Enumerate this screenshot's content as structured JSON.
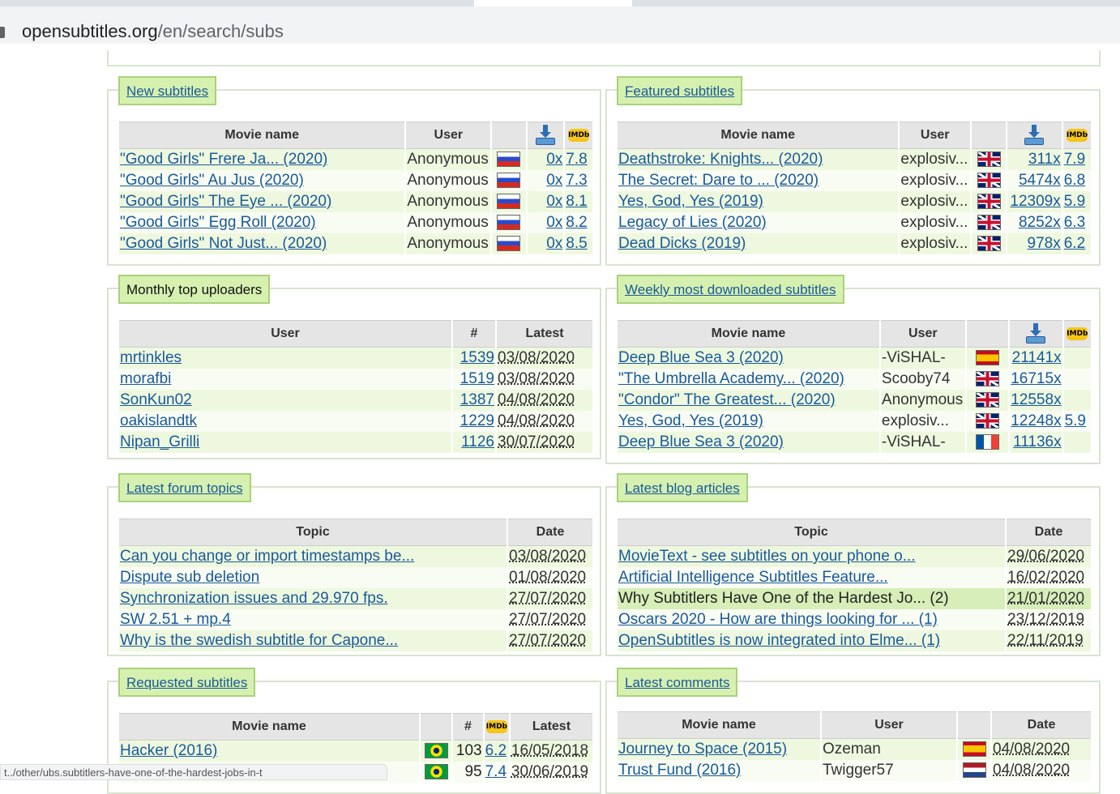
{
  "browser": {
    "url_host": "opensubtitles.org",
    "url_path": "/en/search/subs"
  },
  "new_subtitles": {
    "title": "New subtitles",
    "headers": [
      "Movie name",
      "User"
    ],
    "rows": [
      {
        "movie": "\"Good Girls\" Frere Ja... (2020)",
        "user": "Anonymous",
        "flag": "ru",
        "dl": "0x",
        "imdb": "7.8"
      },
      {
        "movie": "\"Good Girls\" Au Jus (2020)",
        "user": "Anonymous",
        "flag": "ru",
        "dl": "0x",
        "imdb": "7.3"
      },
      {
        "movie": "\"Good Girls\" The Eye ... (2020)",
        "user": "Anonymous",
        "flag": "ru",
        "dl": "0x",
        "imdb": "8.1"
      },
      {
        "movie": "\"Good Girls\" Egg Roll (2020)",
        "user": "Anonymous",
        "flag": "ru",
        "dl": "0x",
        "imdb": "8.2"
      },
      {
        "movie": "\"Good Girls\" Not Just... (2020)",
        "user": "Anonymous",
        "flag": "ru",
        "dl": "0x",
        "imdb": "8.5"
      }
    ]
  },
  "featured_subtitles": {
    "title": "Featured subtitles",
    "headers": [
      "Movie name",
      "User"
    ],
    "rows": [
      {
        "movie": "Deathstroke: Knights... (2020)",
        "user": "explosiv...",
        "flag": "gb",
        "dl": "311x",
        "imdb": "7.9"
      },
      {
        "movie": "The Secret: Dare to ... (2020)",
        "user": "explosiv...",
        "flag": "gb",
        "dl": "5474x",
        "imdb": "6.8"
      },
      {
        "movie": "Yes, God, Yes (2019)",
        "user": "explosiv...",
        "flag": "gb",
        "dl": "12309x",
        "imdb": "5.9"
      },
      {
        "movie": "Legacy of Lies (2020)",
        "user": "explosiv...",
        "flag": "gb",
        "dl": "8252x",
        "imdb": "6.3"
      },
      {
        "movie": "Dead Dicks (2019)",
        "user": "explosiv...",
        "flag": "gb",
        "dl": "978x",
        "imdb": "6.2"
      }
    ]
  },
  "top_uploaders": {
    "title": "Monthly top uploaders",
    "headers": [
      "User",
      "#",
      "Latest"
    ],
    "rows": [
      {
        "user": "mrtinkles",
        "count": "1539",
        "latest": "03/08/2020"
      },
      {
        "user": "morafbi",
        "count": "1519",
        "latest": "03/08/2020"
      },
      {
        "user": "SonKun02",
        "count": "1387",
        "latest": "04/08/2020"
      },
      {
        "user": "oakislandtk",
        "count": "1229",
        "latest": "04/08/2020"
      },
      {
        "user": "Nipan_Grilli",
        "count": "1126",
        "latest": "30/07/2020"
      }
    ]
  },
  "weekly_downloaded": {
    "title": "Weekly most downloaded subtitles",
    "headers": [
      "Movie name",
      "User"
    ],
    "rows": [
      {
        "movie": "Deep Blue Sea 3 (2020)",
        "user": "-ViSHAL-",
        "flag": "es",
        "dl": "21141x",
        "imdb": ""
      },
      {
        "movie": "\"The Umbrella Academy... (2020)",
        "user": "Scooby74",
        "flag": "gb",
        "dl": "16715x",
        "imdb": ""
      },
      {
        "movie": "\"Condor\" The Greatest... (2020)",
        "user": "Anonymous",
        "flag": "gb",
        "dl": "12558x",
        "imdb": ""
      },
      {
        "movie": "Yes, God, Yes (2019)",
        "user": "explosiv...",
        "flag": "gb",
        "dl": "12248x",
        "imdb": "5.9"
      },
      {
        "movie": "Deep Blue Sea 3 (2020)",
        "user": "-ViSHAL-",
        "flag": "fr",
        "dl": "11136x",
        "imdb": ""
      }
    ]
  },
  "forum_topics": {
    "title": "Latest forum topics",
    "headers": [
      "Topic",
      "Date"
    ],
    "rows": [
      {
        "topic": "Can you change or import timestamps be...",
        "date": "03/08/2020"
      },
      {
        "topic": "Dispute sub deletion",
        "date": "01/08/2020"
      },
      {
        "topic": "Synchronization issues and 29.970 fps.",
        "date": "27/07/2020"
      },
      {
        "topic": "SW 2.51 + mp.4",
        "date": "27/07/2020"
      },
      {
        "topic": "Why is the swedish subtitle for Capone...",
        "date": "27/07/2020"
      }
    ]
  },
  "blog_articles": {
    "title": "Latest blog articles",
    "headers": [
      "Topic",
      "Date"
    ],
    "rows": [
      {
        "topic": "MovieText - see subtitles on your phone o...",
        "date": "29/06/2020"
      },
      {
        "topic": "Artificial Intelligence Subtitles Feature...",
        "date": "16/02/2020"
      },
      {
        "topic": "Why Subtitlers Have One of the Hardest Jo... (2)",
        "date": "21/01/2020"
      },
      {
        "topic": "Oscars 2020 - How are things looking for ... (1)",
        "date": "23/12/2019"
      },
      {
        "topic": "OpenSubtitles is now integrated into Elme... (1)",
        "date": "22/11/2019"
      }
    ]
  },
  "requested_subtitles": {
    "title": "Requested subtitles",
    "headers": [
      "Movie name",
      "#",
      "Latest"
    ],
    "rows": [
      {
        "movie": "Hacker (2016)",
        "flag": "br",
        "count": "103",
        "imdb": "6.2",
        "latest": "16/05/2018"
      },
      {
        "movie": "",
        "flag": "br",
        "count": "95",
        "imdb": "7.4",
        "latest": "30/06/2019"
      }
    ]
  },
  "latest_comments": {
    "title": "Latest comments",
    "headers": [
      "Movie name",
      "User",
      "Date"
    ],
    "rows": [
      {
        "movie": "Journey to Space (2015)",
        "user": "Ozeman",
        "flag": "es",
        "date": "04/08/2020"
      },
      {
        "movie": "Trust Fund (2016)",
        "user": "Twigger57",
        "flag": "nl",
        "date": "04/08/2020"
      }
    ]
  },
  "icons": {
    "imdb_text": "IMDb",
    "download": "download-icon"
  },
  "status_bar": {
    "text": "t../other/ubs.subtitlers-have-one-of-the-hardest-jobs-in-t"
  }
}
